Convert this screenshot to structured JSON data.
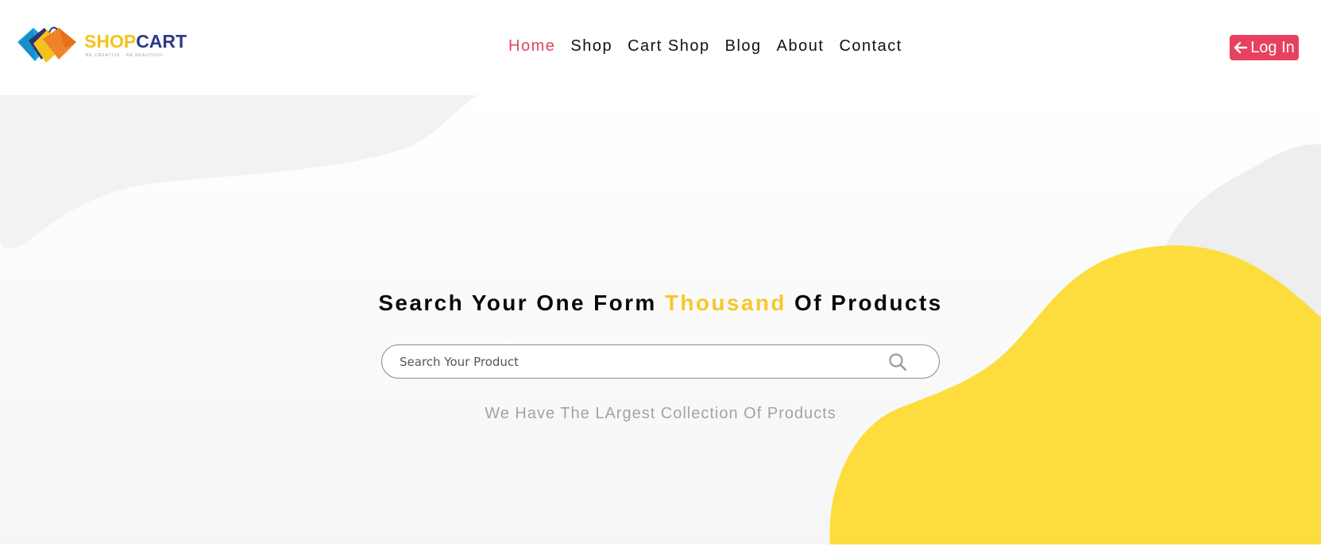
{
  "brand": {
    "name_part1": "SHOP",
    "name_part2": "CART",
    "tagline": "BE CREATIVE · BE BEAUTIFUL",
    "colors": {
      "shop": "#f7c21a",
      "cart": "#2a3a8c"
    }
  },
  "nav": {
    "items": [
      {
        "label": "Home",
        "active": true
      },
      {
        "label": "Shop",
        "active": false
      },
      {
        "label": "Cart Shop",
        "active": false
      },
      {
        "label": "Blog",
        "active": false
      },
      {
        "label": "About",
        "active": false
      },
      {
        "label": "Contact",
        "active": false
      }
    ],
    "active_color": "#e0475f"
  },
  "login": {
    "label": "Log In",
    "icon": "arrow-left-icon",
    "color": "#e8405f"
  },
  "hero": {
    "title_before": "Search Your One Form",
    "title_highlight": "Thousand",
    "title_after": "Of Products",
    "highlight_color": "#f5c92a",
    "search": {
      "placeholder": "Search Your Product",
      "value": "",
      "icon": "search-icon"
    },
    "subtitle": "We Have The LArgest Collection Of Products",
    "blob_color": "#fddd3d"
  }
}
